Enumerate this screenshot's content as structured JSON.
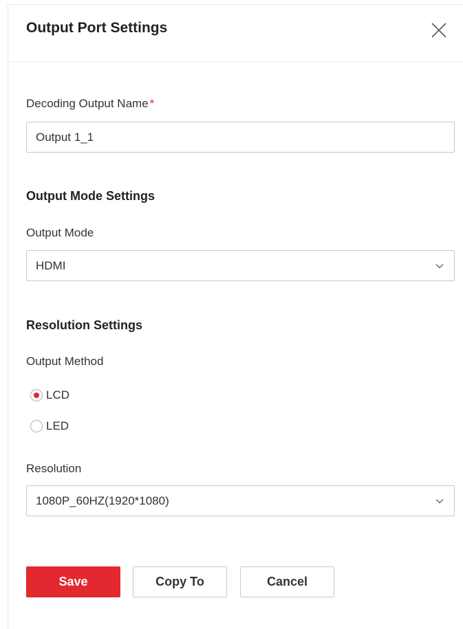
{
  "dialog": {
    "title": "Output Port Settings",
    "close_icon": "close-icon"
  },
  "decoding_output": {
    "label": "Decoding Output Name",
    "required_mark": "*",
    "value": "Output 1_1"
  },
  "output_mode_section": {
    "title": "Output Mode Settings",
    "output_mode": {
      "label": "Output Mode",
      "selected": "HDMI",
      "icon": "chevron-down-icon"
    }
  },
  "resolution_section": {
    "title": "Resolution Settings",
    "output_method": {
      "label": "Output Method",
      "options": [
        {
          "label": "LCD",
          "checked": true
        },
        {
          "label": "LED",
          "checked": false
        }
      ]
    },
    "resolution": {
      "label": "Resolution",
      "selected": "1080P_60HZ(1920*1080)",
      "icon": "chevron-down-icon"
    }
  },
  "footer": {
    "save_label": "Save",
    "copy_label": "Copy To",
    "cancel_label": "Cancel"
  },
  "colors": {
    "accent": "#e4282f",
    "border": "#c9c9c9",
    "text": "#333333"
  }
}
